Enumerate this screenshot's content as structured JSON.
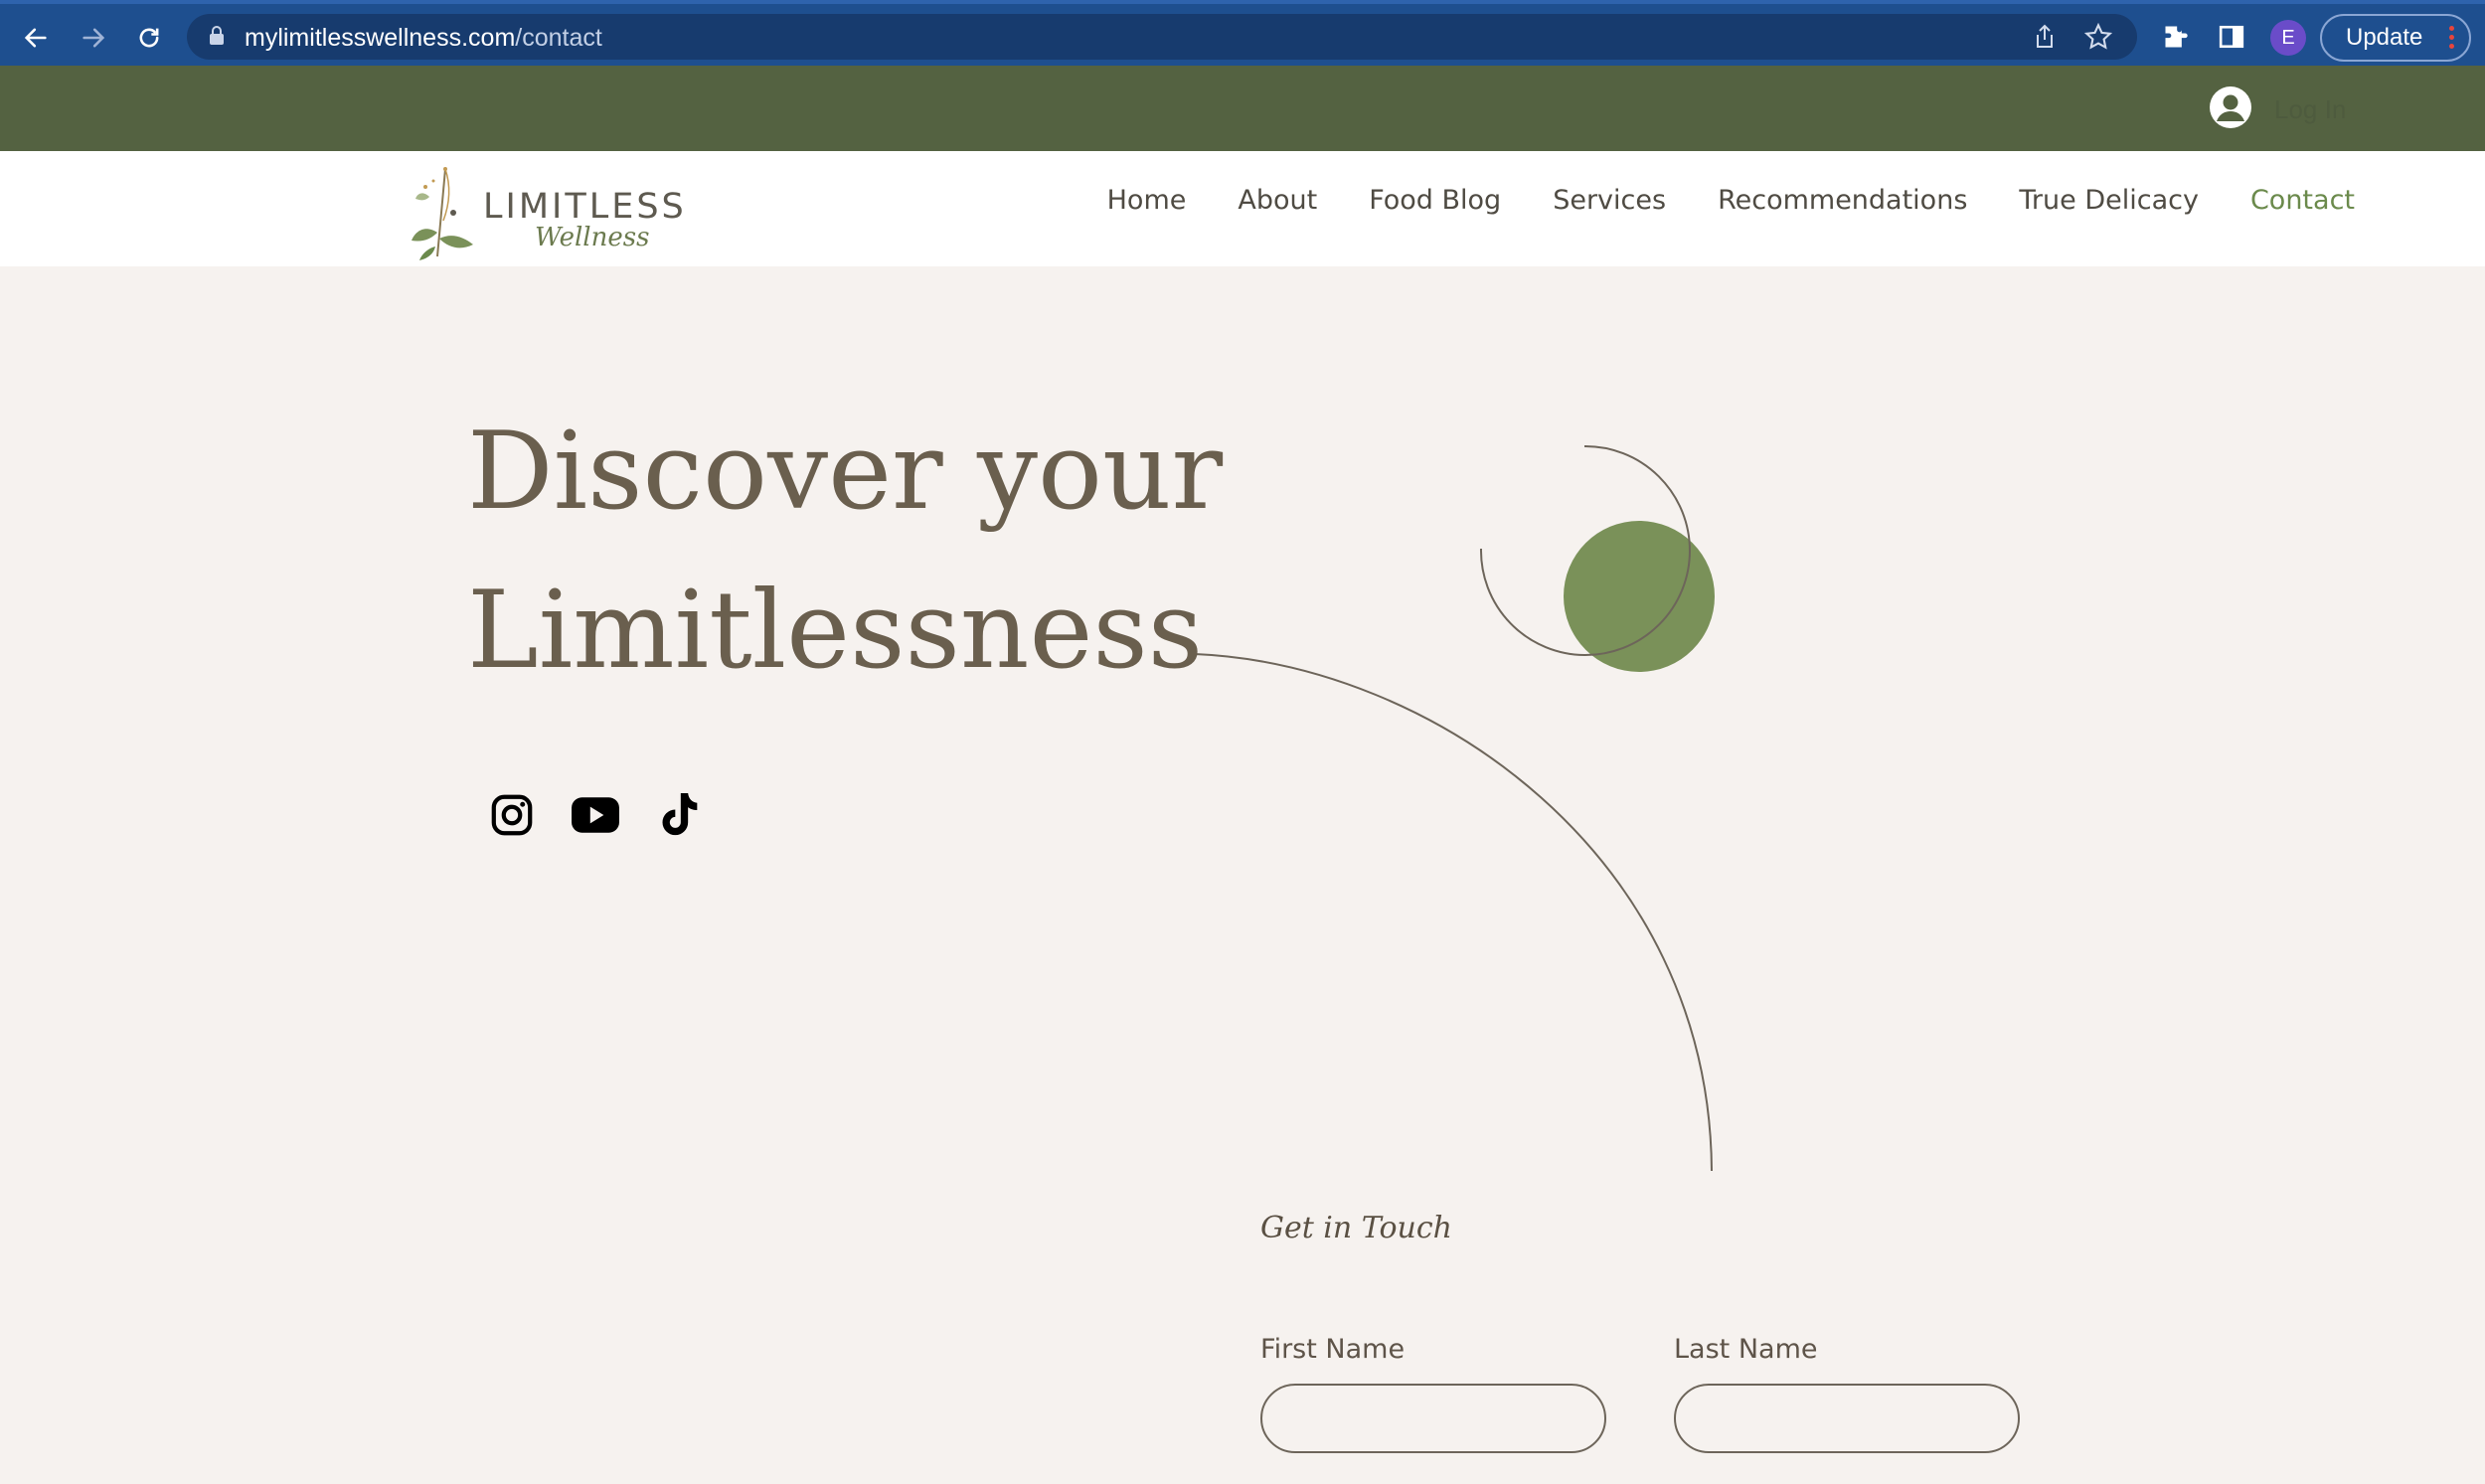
{
  "browser": {
    "url_host": "mylimitlesswellness.com",
    "url_path": "/contact",
    "profile_initial": "E",
    "update_label": "Update"
  },
  "topbar": {
    "login_label": "Log In"
  },
  "header": {
    "logo_word": "LIMITLESS",
    "logo_script": "Wellness",
    "nav": [
      {
        "label": "Home"
      },
      {
        "label": "About"
      },
      {
        "label": "Food Blog"
      },
      {
        "label": "Services"
      },
      {
        "label": "Recommendations"
      },
      {
        "label": "True Delicacy"
      },
      {
        "label": "Contact",
        "active": true
      }
    ]
  },
  "hero": {
    "title_line1": "Discover your",
    "title_line2": "Limitlessness",
    "social": [
      "instagram-icon",
      "youtube-icon",
      "tiktok-icon"
    ]
  },
  "form": {
    "title": "Get in Touch",
    "first_name_label": "First Name",
    "last_name_label": "Last Name",
    "first_name_value": "",
    "last_name_value": ""
  },
  "colors": {
    "topbar": "#546241",
    "accent_green": "#7a9159",
    "nav_active": "#6b8a4c",
    "page_bg": "#f6f2ef",
    "chrome": "#1e4f8f"
  }
}
